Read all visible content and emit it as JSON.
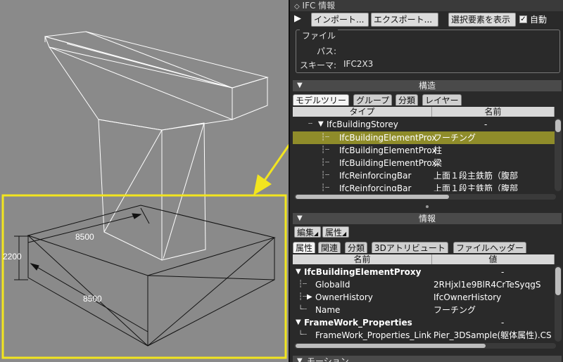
{
  "viewport": {
    "dim_top": "8500",
    "dim_left": "2200",
    "dim_bottom": "8500",
    "highlight_color": "#f2e51f"
  },
  "panel": {
    "title": "IFC 情報",
    "toolbar": {
      "import_label": "インポート...",
      "export_label": "エクスポート...",
      "show_selected_label": "選択要素を表示",
      "auto_label": "自動",
      "auto_checked": true
    },
    "file": {
      "legend": "ファイル",
      "path_label": "パス:",
      "path_value": "",
      "schema_label": "スキーマ:",
      "schema_value": "IFC2X3"
    },
    "structure": {
      "title": "構造",
      "tabs": [
        "モデルツリー",
        "グループ",
        "分類",
        "レイヤー"
      ],
      "columns": [
        "タイプ",
        "名前"
      ],
      "rows": [
        {
          "type": "IfcBuildingStorey",
          "name": "-",
          "indent": 0
        },
        {
          "type": "IfcBuildingElementProx",
          "name": "フーチング",
          "indent": 1,
          "selected": true
        },
        {
          "type": "IfcBuildingElementProx",
          "name": "柱",
          "indent": 1
        },
        {
          "type": "IfcBuildingElementProx",
          "name": "梁",
          "indent": 1
        },
        {
          "type": "IfcReinforcingBar",
          "name": "上面１段主鉄筋（腹部",
          "indent": 1
        },
        {
          "type": "IfcReinforcingBar",
          "name": "上面１段主鉄筋（腹部",
          "indent": 1
        }
      ]
    },
    "info": {
      "title": "情報",
      "edit_label": "編集",
      "attribute_label": "属性",
      "tabs": [
        "属性",
        "関連",
        "分類",
        "3Dアトリビュート",
        "ファイルヘッダー"
      ],
      "columns": [
        "名前",
        "値"
      ],
      "rows": [
        {
          "name": "IfcBuildingElementProxy",
          "value": "-",
          "level": 0
        },
        {
          "name": "GlobalId",
          "value": "2RHjxl1e9BlR4CrTeSyqgS",
          "level": 1
        },
        {
          "name": "OwnerHistory",
          "value": "IfcOwnerHistory",
          "level": 1
        },
        {
          "name": "Name",
          "value": "フーチング",
          "level": 1
        },
        {
          "name": "FrameWork_Properties",
          "value": "-",
          "level": 0
        },
        {
          "name": "FrameWork_Properties_Link",
          "value": "Pier_3DSample(躯体属性).CS",
          "level": 1
        }
      ]
    },
    "next_section": "モーション"
  }
}
